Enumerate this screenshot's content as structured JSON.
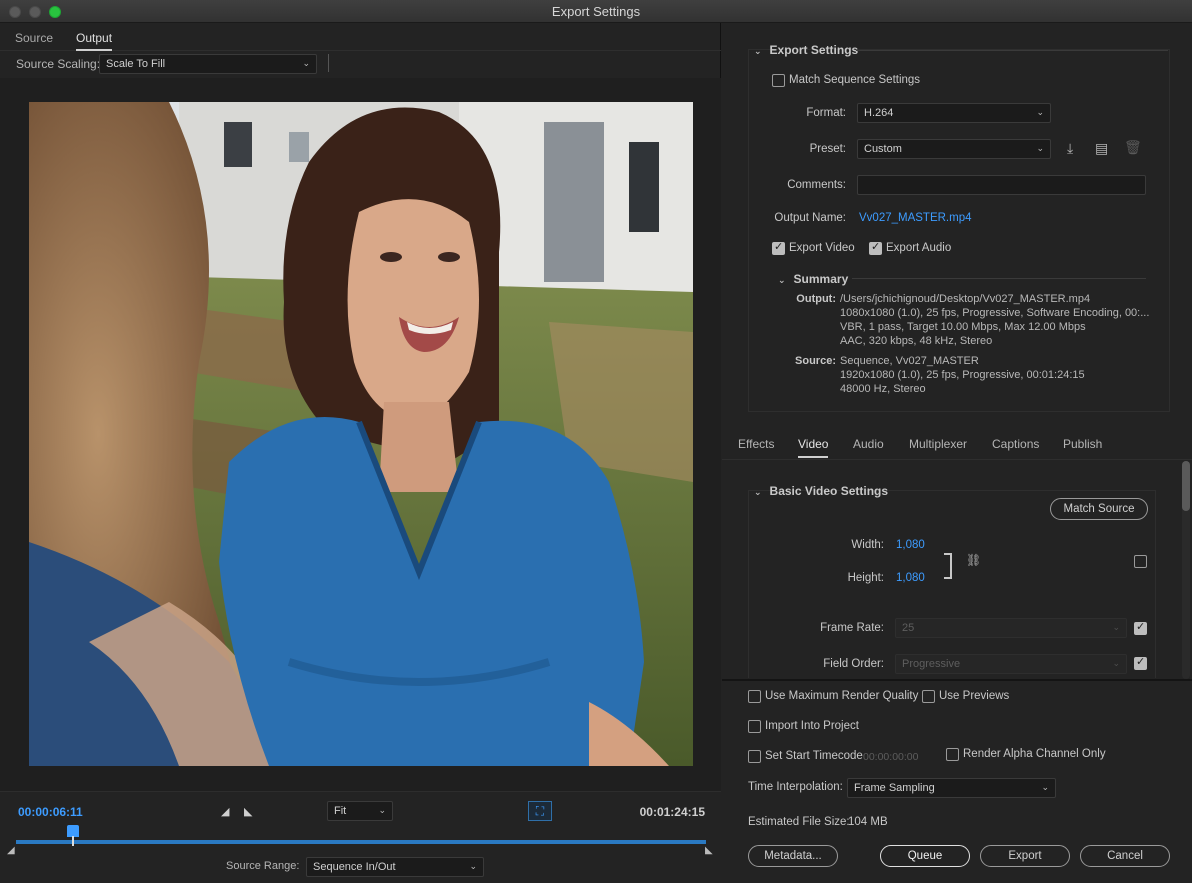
{
  "window": {
    "title": "Export Settings"
  },
  "left": {
    "tabs": [
      {
        "label": "Source"
      },
      {
        "label": "Output"
      }
    ],
    "source_scaling_label": "Source Scaling:",
    "source_scaling_value": "Scale To Fill",
    "current_timecode": "00:00:06:11",
    "total_timecode": "00:01:24:15",
    "zoom_value": "Fit",
    "source_range_label": "Source Range:",
    "source_range_value": "Sequence In/Out"
  },
  "export_settings": {
    "header": "Export Settings",
    "match_sequence_label": "Match Sequence Settings",
    "format_label": "Format:",
    "format_value": "H.264",
    "preset_label": "Preset:",
    "preset_value": "Custom",
    "comments_label": "Comments:",
    "comments_value": "",
    "output_name_label": "Output Name:",
    "output_name_value": "Vv027_MASTER.mp4",
    "export_video_label": "Export Video",
    "export_audio_label": "Export Audio",
    "summary_header": "Summary",
    "summary_output_label": "Output:",
    "summary_output_lines": [
      "/Users/jchichignoud/Desktop/Vv027_MASTER.mp4",
      "1080x1080 (1.0), 25 fps, Progressive, Software Encoding, 00:...",
      "VBR, 1 pass, Target 10.00 Mbps, Max 12.00 Mbps",
      "AAC, 320 kbps, 48 kHz, Stereo"
    ],
    "summary_source_label": "Source:",
    "summary_source_lines": [
      "Sequence, Vv027_MASTER",
      "1920x1080 (1.0), 25 fps, Progressive, 00:01:24:15",
      "48000 Hz, Stereo"
    ]
  },
  "settings_tabs": [
    {
      "label": "Effects"
    },
    {
      "label": "Video"
    },
    {
      "label": "Audio"
    },
    {
      "label": "Multiplexer"
    },
    {
      "label": "Captions"
    },
    {
      "label": "Publish"
    }
  ],
  "video": {
    "header": "Basic Video Settings",
    "match_source_label": "Match Source",
    "width_label": "Width:",
    "width_value": "1,080",
    "height_label": "Height:",
    "height_value": "1,080",
    "frame_rate_label": "Frame Rate:",
    "frame_rate_value": "25",
    "field_order_label": "Field Order:",
    "field_order_value": "Progressive"
  },
  "bottom": {
    "max_render_label": "Use Maximum Render Quality",
    "use_previews_label": "Use Previews",
    "import_project_label": "Import Into Project",
    "start_timecode_label": "Set Start Timecode",
    "start_timecode_value": "00:00:00:00",
    "render_alpha_label": "Render Alpha Channel Only",
    "time_interp_label": "Time Interpolation:",
    "time_interp_value": "Frame Sampling",
    "file_size_label": "Estimated File Size:",
    "file_size_value": "104 MB",
    "metadata_label": "Metadata...",
    "queue_label": "Queue",
    "export_label": "Export",
    "cancel_label": "Cancel"
  }
}
